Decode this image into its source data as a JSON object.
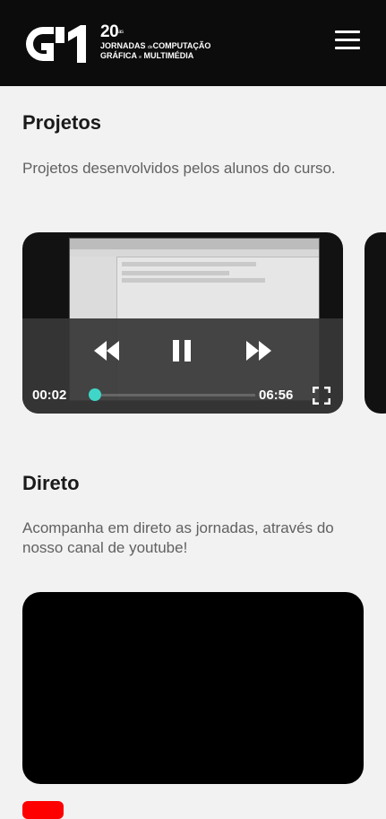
{
  "header": {
    "logo_number": "20",
    "logo_sup": "as",
    "logo_line1": "JORNADAS",
    "logo_line1_small": "de",
    "logo_line1_b": "COMPUTAÇÃO",
    "logo_line2": "GRÁFICA",
    "logo_line2_small": "e",
    "logo_line2_b": "MULTIMÉDIA",
    "menu_icon": "hamburger-menu-icon"
  },
  "projetos": {
    "title": "Projetos",
    "description": "Projetos desenvolvidos pelos alunos do curso.",
    "video": {
      "current_time": "00:02",
      "duration": "06:56",
      "progress": 0.005,
      "accent_color": "#3fd6c8"
    }
  },
  "direto": {
    "title": "Direto",
    "description": "Acompanha em direto as jornadas, através do nosso canal de youtube!"
  },
  "colors": {
    "header_bg": "#0c0c0c",
    "page_bg": "#f2f2f2",
    "youtube_red": "#ff0000"
  }
}
